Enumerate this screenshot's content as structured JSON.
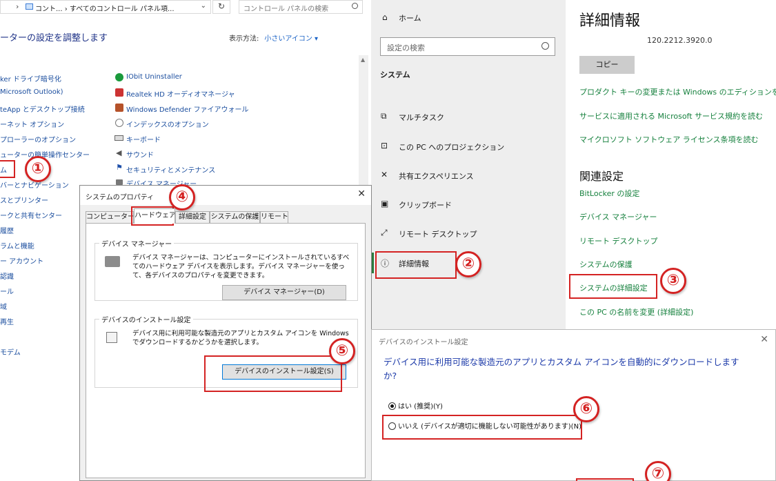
{
  "control_panel": {
    "address_path": "コント... › すべてのコントロール パネル項...",
    "search_placeholder": "コントロール パネルの検索",
    "heading": "ーターの設定を調整します",
    "view_by_label": "表示方法:",
    "view_by_value": "小さいアイコン ▾",
    "left_column": [
      "ker ドライブ暗号化",
      "Microsoft Outlook)",
      "teApp とデスクトップ接続",
      "ーネット オプション",
      "プローラーのオプション",
      "ューターの簡単操作センター",
      "ム",
      "バーとナビゲーション",
      "スとプリンター",
      "ークと共有センター",
      "履歴",
      "ラムと機能",
      "ー アカウント",
      "認識",
      "ール",
      "域",
      "再生",
      "モデム"
    ],
    "right_column": [
      "IObit Uninstaller",
      "Realtek HD オーディオマネージャ",
      "Windows Defender ファイアウォール",
      "インデックスのオプション",
      "キーボード",
      "サウンド",
      "セキュリティとメンテナンス",
      "デバイス マネージャー"
    ]
  },
  "settings": {
    "nav": {
      "home": "ホーム",
      "search_placeholder": "設定の検索",
      "section": "システム",
      "items": [
        "マルチタスク",
        "この PC へのプロジェクション",
        "共有エクスペリエンス",
        "クリップボード",
        "リモート デスクトップ",
        "詳細情報"
      ]
    },
    "main": {
      "title": "詳細情報",
      "version": "120.2212.3920.0",
      "copy_button": "コピー",
      "links": [
        "プロダクト キーの変更または Windows のエディションをアップ",
        "サービスに適用される Microsoft サービス規約を読む",
        "マイクロソフト ソフトウェア ライセンス条項を読む"
      ],
      "related_title": "関連設定",
      "related_links": [
        "BitLocker の設定",
        "デバイス マネージャー",
        "リモート デスクトップ",
        "システムの保護",
        "システムの詳細設定",
        "この PC の名前を変更 (詳細設定)"
      ]
    }
  },
  "system_properties": {
    "title": "システムのプロパティ",
    "close": "✕",
    "tabs": [
      "コンピューター名",
      "ハードウェア",
      "詳細設定",
      "システムの保護",
      "リモート"
    ],
    "device_manager": {
      "group_title": "デバイス マネージャー",
      "description": "デバイス マネージャーは、コンピューターにインストールされているすべてのハードウェア デバイスを表示します。デバイス マネージャーを使って、各デバイスのプロパティを変更できます。",
      "button": "デバイス マネージャー(D)"
    },
    "install_settings": {
      "group_title": "デバイスのインストール設定",
      "description": "デバイス用に利用可能な製造元のアプリとカスタム アイコンを Windows でダウンロードするかどうかを選択します。",
      "button": "デバイスのインストール設定(S)"
    }
  },
  "device_install_dialog": {
    "title": "デバイスのインストール設定",
    "close": "✕",
    "question": "デバイス用に利用可能な製造元のアプリとカスタム アイコンを自動的にダウンロードしますか?",
    "option_yes": "はい (推奨)(Y)",
    "option_no": "いいえ (デバイスが適切に機能しない可能性があります)(N)"
  },
  "step_badges": [
    "①",
    "②",
    "③",
    "④",
    "⑤",
    "⑥",
    "⑦"
  ]
}
